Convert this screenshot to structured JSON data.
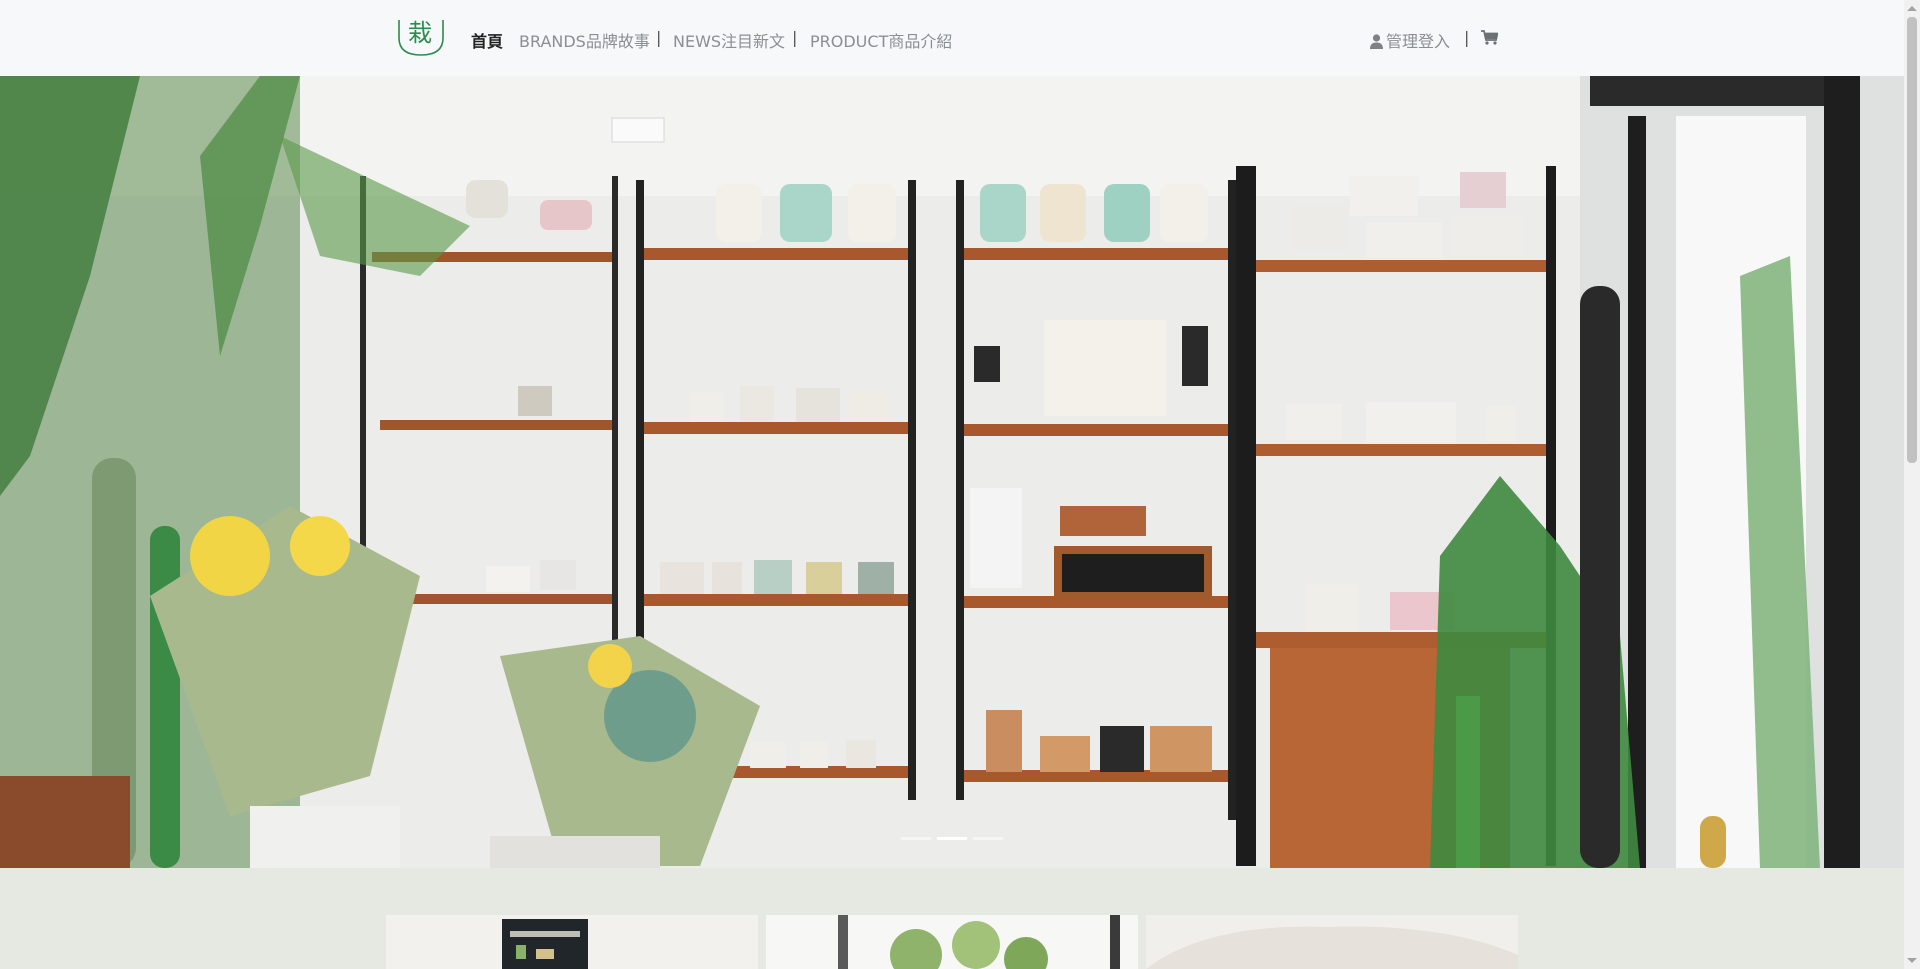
{
  "brand": {
    "logo_char": "栽"
  },
  "nav": {
    "home": "首頁",
    "brands": "BRANDS品牌故事",
    "news": "NEWS注目新文",
    "product": "PRODUCT商品介紹",
    "separator": "|"
  },
  "account": {
    "login_label": "管理登入",
    "separator": "|"
  },
  "carousel": {
    "slide_count": 3,
    "active_index": 1
  },
  "colors": {
    "brand_green": "#2e8a4e",
    "section_bg": "#e5e9e1",
    "nav_bg": "#f6f8f9"
  },
  "icons": {
    "user": "user-icon",
    "cart": "cart-icon"
  }
}
